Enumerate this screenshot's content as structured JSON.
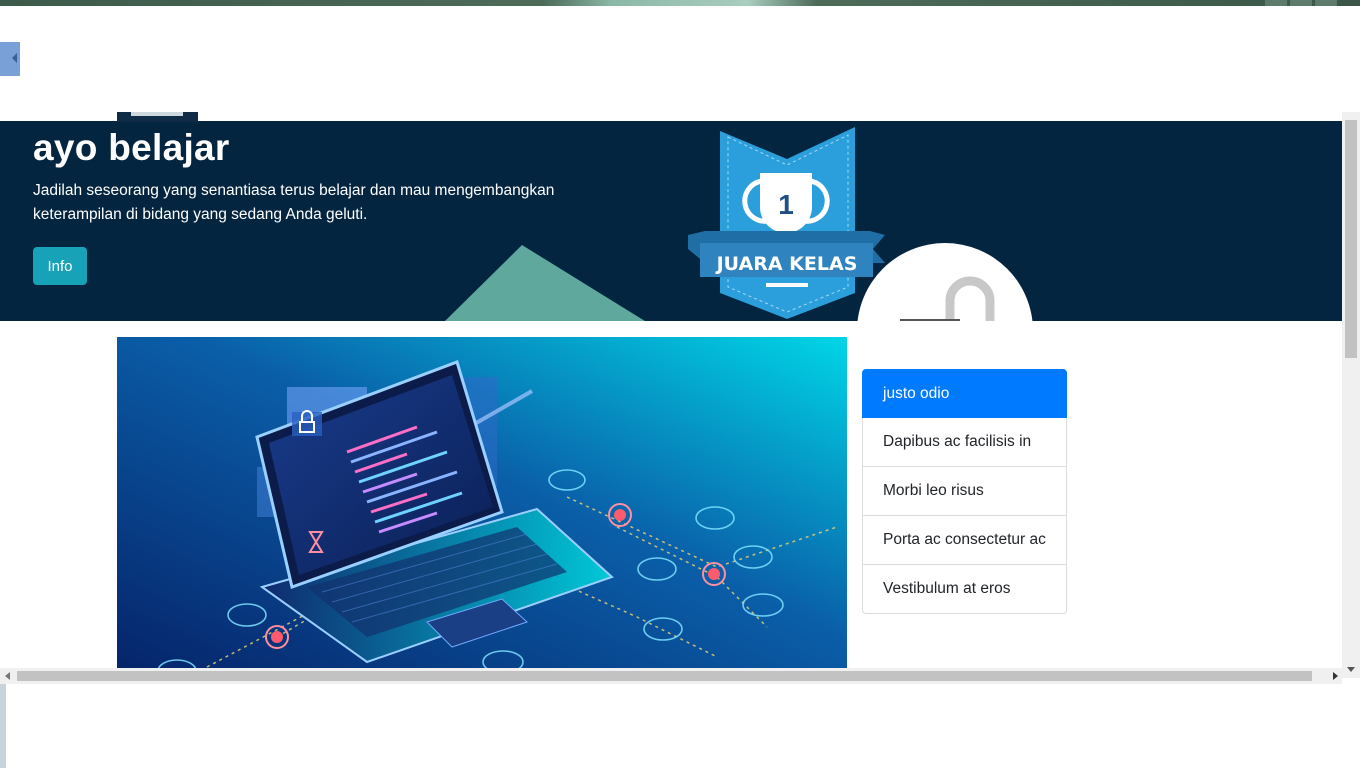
{
  "hero": {
    "title": "ayo belajar",
    "lead": "Jadilah seseorang yang senantiasa terus belajar dan mau mengembangkan keterampilan di bidang yang sedang Anda geluti.",
    "button_label": "Info",
    "badge_number": "1",
    "badge_text": "JUARA KELAS"
  },
  "list_group": {
    "items": [
      {
        "label": "justo odio",
        "active": true
      },
      {
        "label": "Dapibus ac facilisis in",
        "active": false
      },
      {
        "label": "Morbi leo risus",
        "active": false
      },
      {
        "label": "Porta ac consectetur ac",
        "active": false
      },
      {
        "label": "Vestibulum at eros",
        "active": false
      }
    ]
  },
  "colors": {
    "hero_bg": "#03253f",
    "info_button": "#17a2b8",
    "list_active": "#007bff",
    "badge_blue": "#2b9fdc"
  }
}
